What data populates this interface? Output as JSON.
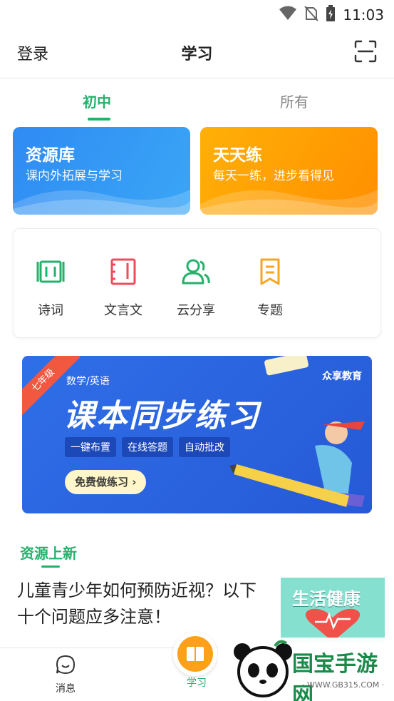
{
  "status_bar": {
    "time": "11:03",
    "icons": [
      "wifi-icon",
      "no-sim-icon",
      "battery-charging-icon"
    ]
  },
  "header": {
    "login_label": "登录",
    "title": "学习",
    "scan_icon": "scan-icon"
  },
  "tabs": [
    {
      "label": "初中",
      "active": true
    },
    {
      "label": "所有",
      "active": false
    }
  ],
  "feature_cards": [
    {
      "title": "资源库",
      "subtitle": "课内外拓展与学习",
      "color": "#2f8bf3"
    },
    {
      "title": "天天练",
      "subtitle": "每天一练，进步看得见",
      "color": "#ffa500"
    }
  ],
  "categories": [
    {
      "label": "诗词",
      "icon": "scroll-icon",
      "color": "#23b26b"
    },
    {
      "label": "文言文",
      "icon": "notebook-icon",
      "color": "#ef4b5c"
    },
    {
      "label": "云分享",
      "icon": "users-icon",
      "color": "#23b26b"
    },
    {
      "label": "专题",
      "icon": "bookmark-icon",
      "color": "#f5a623"
    }
  ],
  "banner": {
    "ribbon": "七年级",
    "subject": "数学/英语",
    "title": "课本同步练习",
    "tags": [
      "一键布置",
      "在线答题",
      "自动批改"
    ],
    "cta": "免费做练习 ›",
    "brand": "众享教育"
  },
  "news_section": {
    "title": "资源上新",
    "article_title": "儿童青少年如何预防近视？以下十个问题应多注意！",
    "thumbnail_text": "生活健康"
  },
  "bottom_nav": [
    {
      "label": "消息",
      "icon": "message-icon"
    },
    {
      "label": "学习",
      "icon": "book-icon",
      "active": true
    }
  ],
  "watermark": {
    "text": "国宝手游网",
    "url": "· WWW.GB315.COM ·"
  },
  "colors": {
    "accent": "#23b26b",
    "blue_card": "#2f8bf3",
    "orange_card": "#ffa500"
  }
}
